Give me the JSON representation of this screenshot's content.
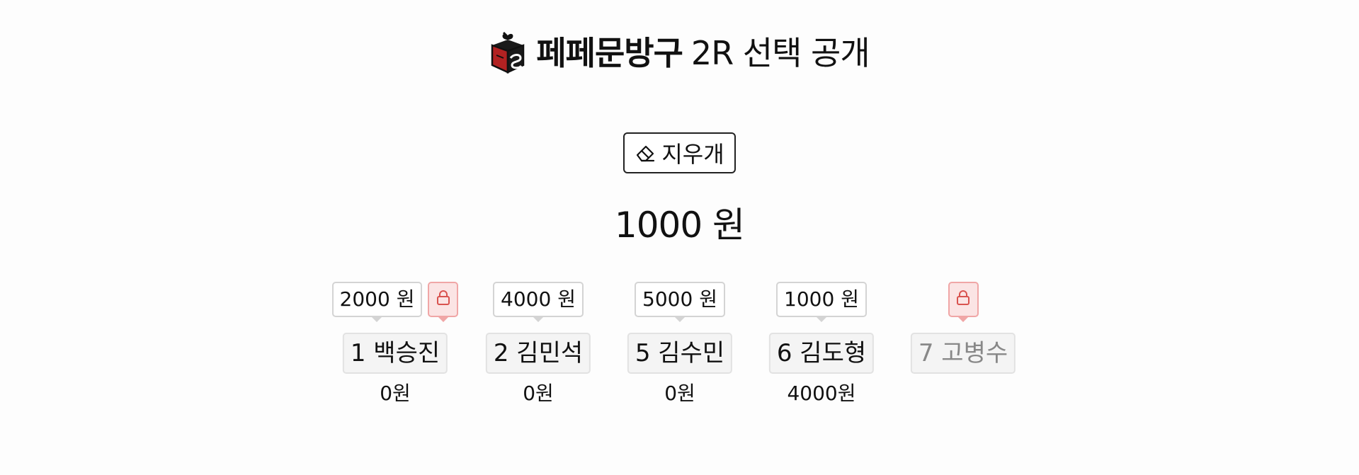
{
  "header": {
    "brand": "페페문방구",
    "subtitle": "2R 선택 공개",
    "logo_icon": "gift-box-logo-icon"
  },
  "toolbar": {
    "eraser_label": "지우개",
    "eraser_icon": "eraser-icon"
  },
  "current_amount": "1000 원",
  "colors": {
    "lock_bg": "#fbe4e4",
    "lock_border": "#f0a6a6",
    "lock_icon": "#d9534f",
    "logo_red": "#b22222"
  },
  "players": [
    {
      "bid": "2000 원",
      "locked": true,
      "name": "1 백승진",
      "money": "0원",
      "disabled": false
    },
    {
      "bid": "4000 원",
      "locked": false,
      "name": "2 김민석",
      "money": "0원",
      "disabled": false
    },
    {
      "bid": "5000 원",
      "locked": false,
      "name": "5 김수민",
      "money": "0원",
      "disabled": false
    },
    {
      "bid": "1000 원",
      "locked": false,
      "name": "6 김도형",
      "money": "4000원",
      "disabled": false
    },
    {
      "bid": "",
      "locked": true,
      "name": "7 고병수",
      "money": "",
      "disabled": true
    }
  ]
}
